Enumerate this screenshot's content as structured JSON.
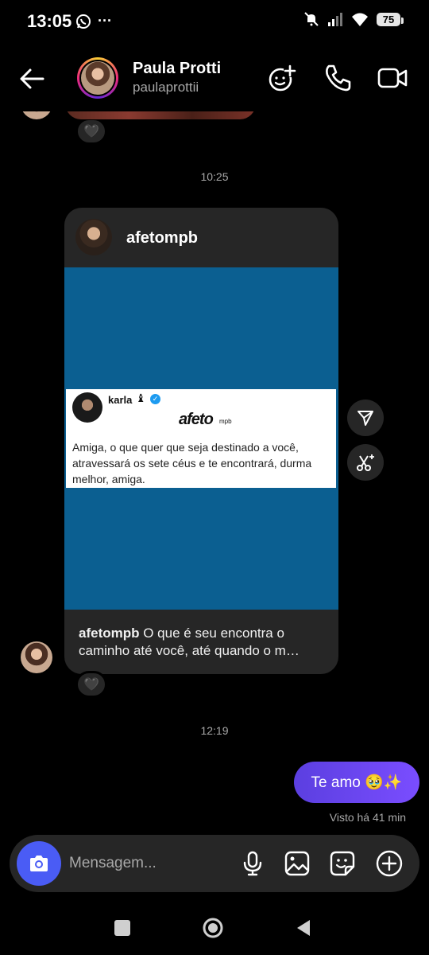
{
  "status_bar": {
    "time": "13:05",
    "more": "···",
    "battery": "75",
    "icons": [
      "whatsapp-icon",
      "mute-icon",
      "signal-icon",
      "wifi-icon",
      "battery-icon"
    ]
  },
  "header": {
    "name": "Paula Protti",
    "username": "paulaprottii",
    "icons": [
      "back-arrow-icon",
      "group-add-icon",
      "phone-icon",
      "video-icon"
    ]
  },
  "timestamps": [
    "10:25",
    "12:19"
  ],
  "shared_post": {
    "author": "afetompb",
    "tweet": {
      "name": "karla",
      "chess": "♝",
      "logo": "afeto",
      "logo_sub": "mpb",
      "text": "Amiga, o que quer que seja destinado a você, atravessará os sete céus e te encontrará, durma melhor, amiga."
    },
    "caption_author": "afetompb",
    "caption_text": "O que é seu encontra o caminho até você, até quando o m…"
  },
  "reaction": "🖤",
  "sent_message": "Te amo 🥹✨",
  "seen_status": "Visto há 41 min",
  "composer": {
    "placeholder": "Mensagem..."
  },
  "colors": {
    "accent": "#4a5cf5",
    "bubble": "#6a45f0",
    "post_bg": "#0b5f91",
    "card": "#262626"
  }
}
